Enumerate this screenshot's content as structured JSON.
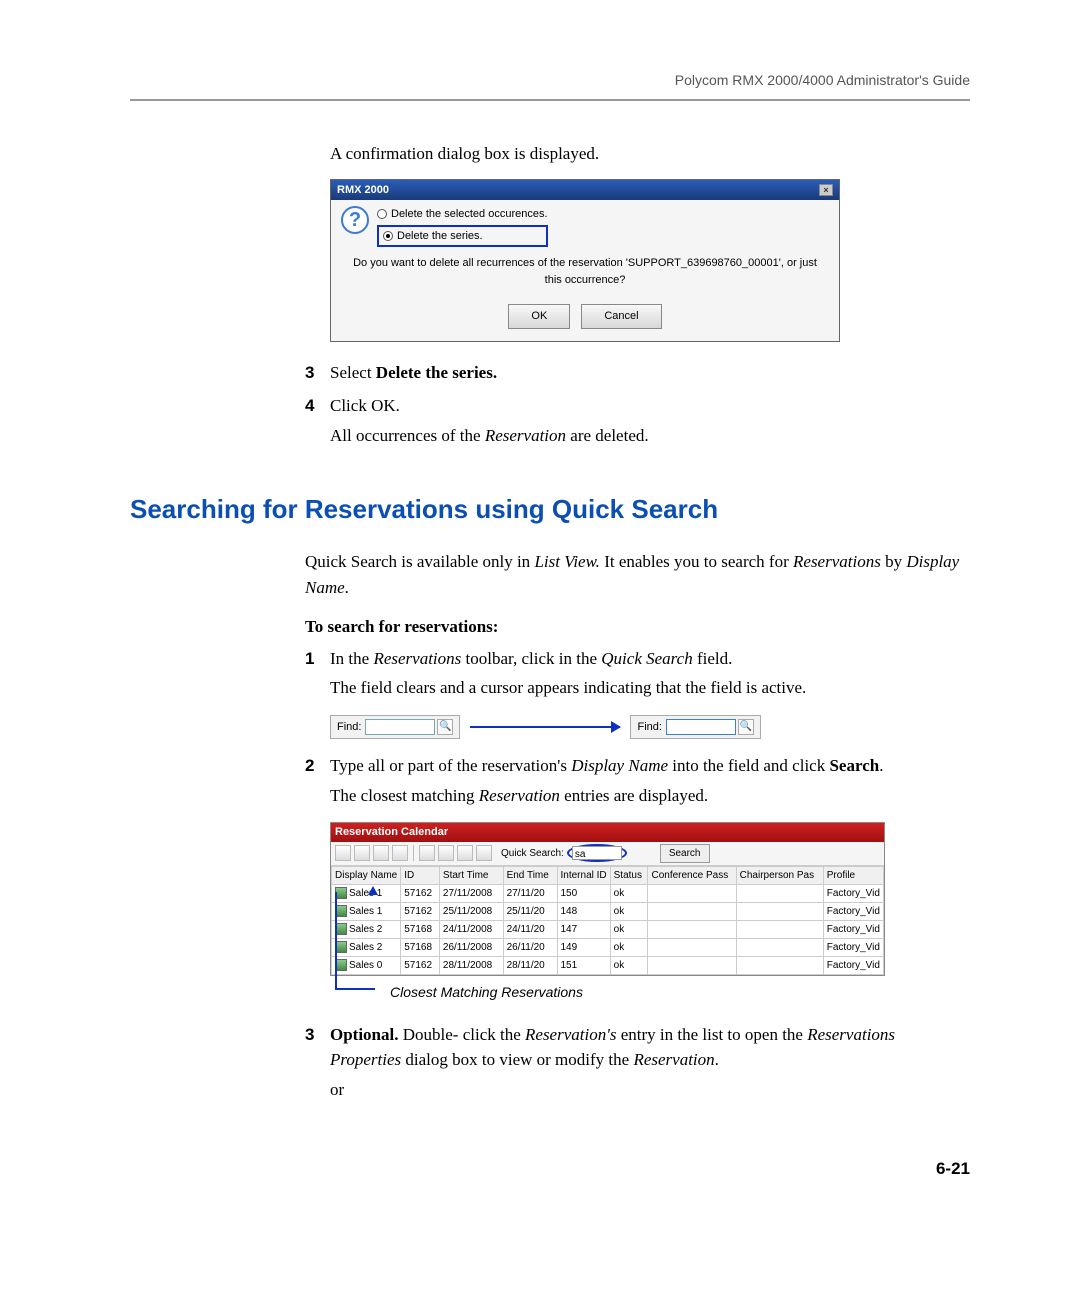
{
  "header": {
    "guide": "Polycom RMX 2000/4000 Administrator's Guide"
  },
  "intro": "A confirmation dialog box is displayed.",
  "dialog": {
    "title": "RMX 2000",
    "opt1": "Delete the selected occurences.",
    "opt2": "Delete the series.",
    "msg": "Do you want to delete all recurrences of the reservation 'SUPPORT_639698760_00001', or just this occurrence?",
    "ok": "OK",
    "cancel": "Cancel"
  },
  "step3": {
    "num": "3",
    "a": "Select ",
    "b": "Delete the series."
  },
  "step4": {
    "num": "4",
    "a": "Click OK.",
    "b1": "All occurrences of the ",
    "b2": "Reservation",
    "b3": " are deleted."
  },
  "section_heading": "Searching for Reservations using Quick Search",
  "qs_para": {
    "a": "Quick Search is available only in ",
    "b": "List View.",
    "c": " It enables you to search for ",
    "d": "Reservations",
    "e": " by ",
    "f": "Display Name",
    "g": "."
  },
  "tosearch": "To search for reservations:",
  "s1": {
    "num": "1",
    "a": "In the ",
    "b": "Reservations",
    "c": " toolbar, click in the ",
    "d": "Quick Search",
    "e": " field.",
    "f": "The field clears and a cursor appears indicating that the field is active."
  },
  "find": {
    "label": "Find:"
  },
  "s2": {
    "num": "2",
    "a": "Type all or part of the reservation's ",
    "b": "Display Name",
    "c": " into the field and click ",
    "d": "Search",
    "e": ".",
    "f1": "The closest matching ",
    "f2": "Reservation",
    "f3": " entries are displayed."
  },
  "res": {
    "title": "Reservation Calendar",
    "qs_label": "Quick Search:",
    "qs_value": "sa",
    "search_btn": "Search",
    "cols": {
      "dn": "Display Name",
      "id": "ID",
      "st": "Start Time",
      "et": "End Time",
      "iid": "Internal ID",
      "stat": "Status",
      "cp": "Conference Pass",
      "chp": "Chairperson Pas",
      "pr": "Profile"
    },
    "rows": [
      {
        "dn": "Sales 1",
        "id": "57162",
        "st": "27/11/2008",
        "et": "27/11/20",
        "iid": "150",
        "stat": "ok",
        "cp": "",
        "chp": "",
        "pr": "Factory_Vid"
      },
      {
        "dn": "Sales 1",
        "id": "57162",
        "st": "25/11/2008",
        "et": "25/11/20",
        "iid": "148",
        "stat": "ok",
        "cp": "",
        "chp": "",
        "pr": "Factory_Vid"
      },
      {
        "dn": "Sales 2",
        "id": "57168",
        "st": "24/11/2008",
        "et": "24/11/20",
        "iid": "147",
        "stat": "ok",
        "cp": "",
        "chp": "",
        "pr": "Factory_Vid"
      },
      {
        "dn": "Sales 2",
        "id": "57168",
        "st": "26/11/2008",
        "et": "26/11/20",
        "iid": "149",
        "stat": "ok",
        "cp": "",
        "chp": "",
        "pr": "Factory_Vid"
      },
      {
        "dn": "Sales 0",
        "id": "57162",
        "st": "28/11/2008",
        "et": "28/11/20",
        "iid": "151",
        "stat": "ok",
        "cp": "",
        "chp": "",
        "pr": "Factory_Vid"
      }
    ]
  },
  "callout": "Closest Matching Reservations",
  "s3": {
    "num": "3",
    "a": "Optional.",
    "b": " Double- click the ",
    "c": "Reservation's",
    "d": " entry in the list to open the ",
    "e": "Reservations Properties",
    "f": " dialog box to view or modify the ",
    "g": "Reservation",
    "h": ".",
    "or": "or"
  },
  "footer": "6-21"
}
